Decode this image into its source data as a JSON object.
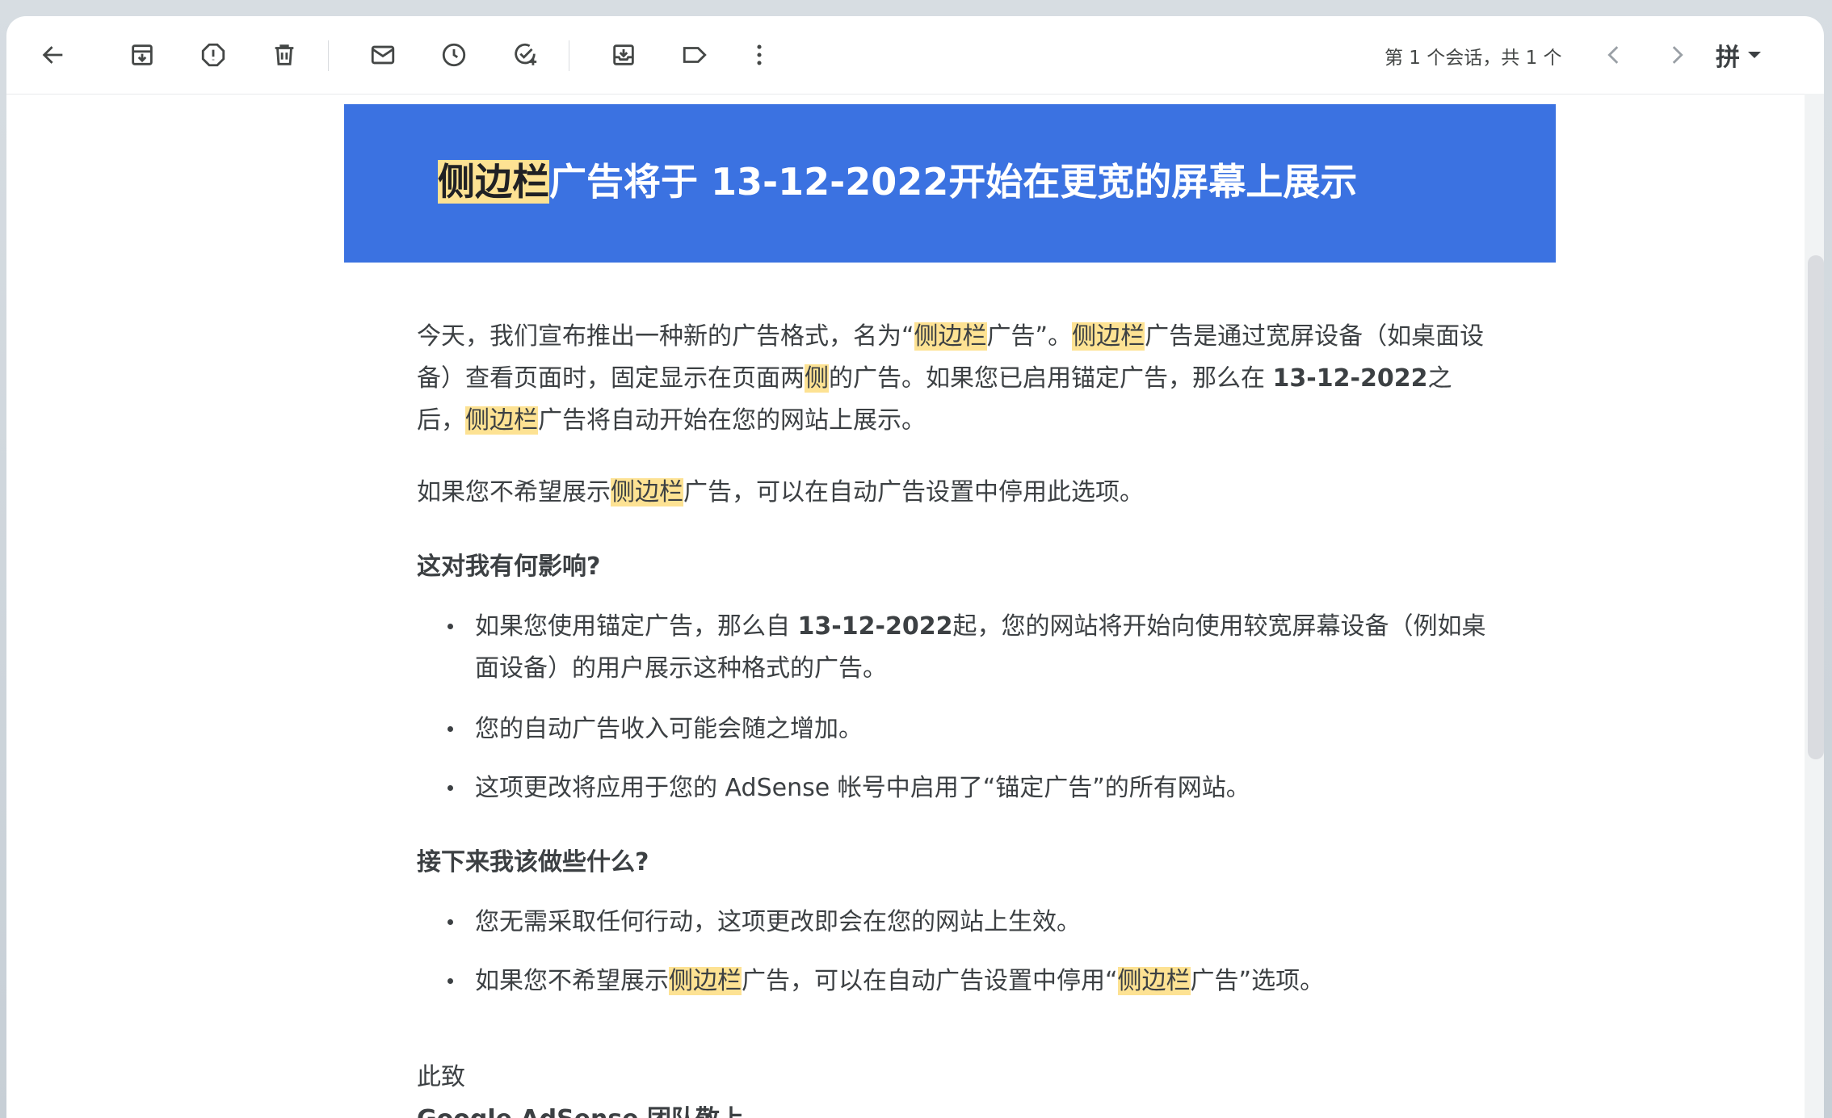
{
  "toolbar": {
    "pager_text": "第 1 个会话，共 1 个",
    "ime_label": "拼"
  },
  "email": {
    "banner_title_highlight": "侧边栏",
    "banner_title_rest": "广告将于 13-12-2022开始在更宽的屏幕上展示",
    "p1": {
      "a": "今天，我们宣布推出一种新的广告格式，名为“",
      "hl1": "侧边栏",
      "b": "广告”。",
      "hl2": "侧边栏",
      "c": "广告是通过宽屏设备（如桌面设备）查看页面时，固定显示在页面两",
      "hl3": "侧",
      "d": "的广告。如果您已启用锚定广告，那么在 ",
      "bold_date": "13-12-2022",
      "e": "之后，",
      "hl4": "侧边栏",
      "f": "广告将自动开始在您的网站上展示。"
    },
    "p2": {
      "a": "如果您不希望展示",
      "hl": "侧边栏",
      "b": "广告，可以在自动广告设置中停用此选项。"
    },
    "heading1": "这对我有何影响?",
    "bullets1": {
      "b1_a": "如果您使用锚定广告，那么自 ",
      "b1_bold": "13-12-2022",
      "b1_b": "起，您的网站将开始向使用较宽屏幕设备（例如桌面设备）的用户展示这种格式的广告。",
      "b2": "您的自动广告收入可能会随之增加。",
      "b3": "这项更改将应用于您的 AdSense 帐号中启用了“锚定广告”的所有网站。"
    },
    "heading2": "接下来我该做些什么?",
    "bullets2": {
      "b1": "您无需采取任何行动，这项更改即会在您的网站上生效。",
      "b2_a": "如果您不希望展示",
      "b2_hl1": "侧边栏",
      "b2_b": "广告，可以在自动广告设置中停用“",
      "b2_hl2": "侧边栏",
      "b2_c": "广告”选项。"
    },
    "closing": "此致",
    "signature": "Google AdSense 团队敬上"
  }
}
